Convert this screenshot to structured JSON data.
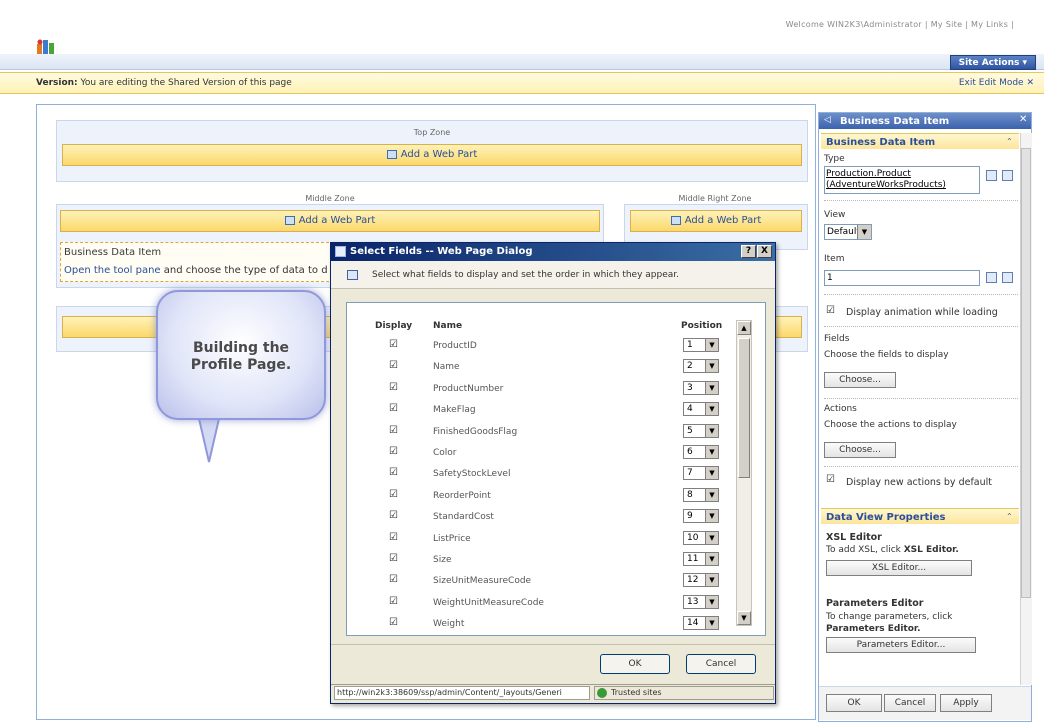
{
  "header": {
    "welcome_text": "Welcome WIN2K3\\Administrator  |  My Site  |  My Links  |",
    "site_actions": "Site Actions ▾"
  },
  "version_bar": {
    "label": "Version:",
    "text": "You are editing the Shared Version of this page",
    "exit_edit": "Exit Edit Mode ✕"
  },
  "zones": {
    "top": {
      "label": "Top Zone",
      "add": "Add a Web Part"
    },
    "middle": {
      "label": "Middle Zone",
      "add": "Add a Web Part"
    },
    "middle_right": {
      "label": "Middle Right Zone",
      "add": "Add a Web Part"
    }
  },
  "webpart": {
    "title": "Business Data Item",
    "link_text": "Open the tool pane",
    "rest_text": " and choose the type of data to d"
  },
  "callout": {
    "line1": "Building the",
    "line2": "Profile Page."
  },
  "dialog": {
    "title": "Select Fields -- Web Page Dialog",
    "help": "?",
    "close": "X",
    "instruction": "Select what fields to display and set the order in which they appear.",
    "columns": {
      "display": "Display",
      "name": "Name",
      "position": "Position"
    },
    "fields": [
      {
        "name": "ProductID",
        "position": "1"
      },
      {
        "name": "Name",
        "position": "2"
      },
      {
        "name": "ProductNumber",
        "position": "3"
      },
      {
        "name": "MakeFlag",
        "position": "4"
      },
      {
        "name": "FinishedGoodsFlag",
        "position": "5"
      },
      {
        "name": "Color",
        "position": "6"
      },
      {
        "name": "SafetyStockLevel",
        "position": "7"
      },
      {
        "name": "ReorderPoint",
        "position": "8"
      },
      {
        "name": "StandardCost",
        "position": "9"
      },
      {
        "name": "ListPrice",
        "position": "10"
      },
      {
        "name": "Size",
        "position": "11"
      },
      {
        "name": "SizeUnitMeasureCode",
        "position": "12"
      },
      {
        "name": "WeightUnitMeasureCode",
        "position": "13"
      },
      {
        "name": "Weight",
        "position": "14"
      }
    ],
    "ok": "OK",
    "cancel": "Cancel",
    "status_url": "http://win2k3:38609/ssp/admin/Content/_layouts/Generi",
    "status_zone": "Trusted sites"
  },
  "toolpane": {
    "title": "Business Data Item",
    "section1": "Business Data Item",
    "type_label": "Type",
    "type_value_1": "Production.Product",
    "type_value_2": "(AdventureWorksProducts)",
    "view_label": "View",
    "view_value": "Default",
    "item_label": "Item",
    "item_value": "1",
    "display_animation": "Display animation while loading",
    "fields_label": "Fields",
    "fields_desc": "Choose the fields to display",
    "fields_btn": "Choose...",
    "actions_label": "Actions",
    "actions_desc": "Choose the actions to display",
    "actions_btn": "Choose...",
    "display_new_actions": "Display new actions by default",
    "section2": "Data View Properties",
    "xsl_title": "XSL Editor",
    "xsl_desc_prefix": "To add XSL, click ",
    "xsl_desc_bold": "XSL Editor.",
    "xsl_btn": "XSL Editor...",
    "params_title": "Parameters Editor",
    "params_desc_1": "To change parameters, click",
    "params_desc_2": "Parameters Editor.",
    "params_btn": "Parameters Editor...",
    "ok": "OK",
    "cancel": "Cancel",
    "apply": "Apply"
  }
}
